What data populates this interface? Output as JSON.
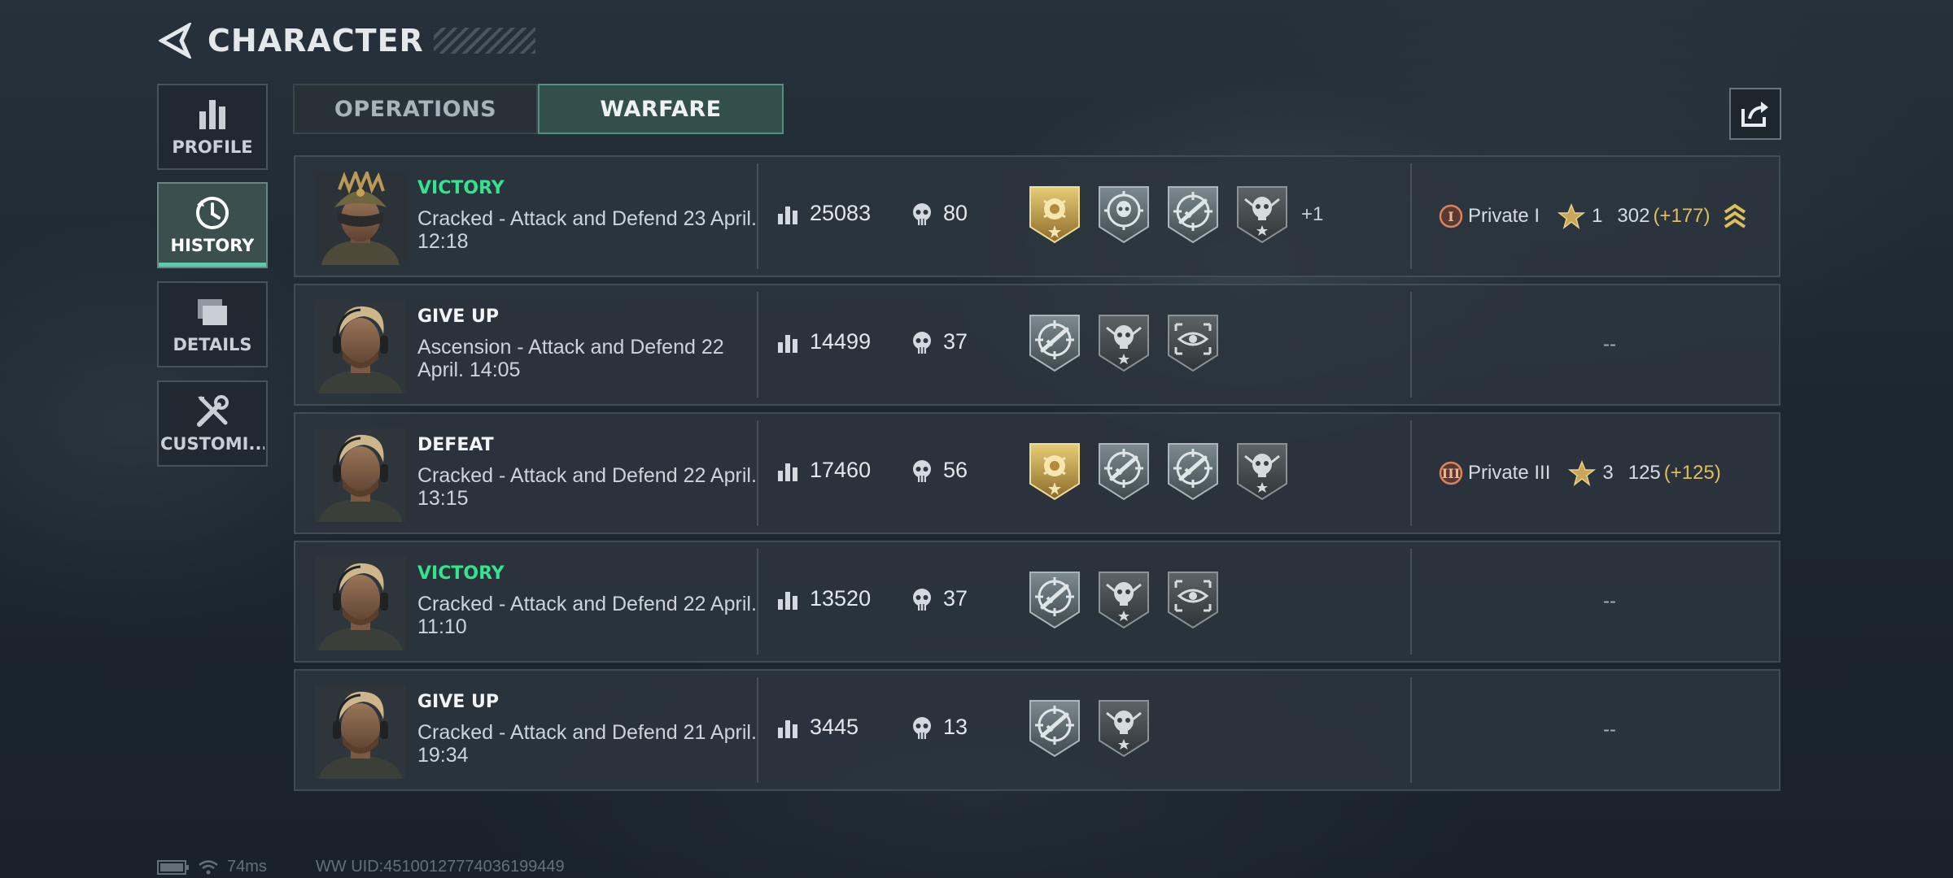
{
  "header": {
    "title": "CHARACTER"
  },
  "sidebar": {
    "items": [
      {
        "label": "PROFILE"
      },
      {
        "label": "HISTORY",
        "active": true
      },
      {
        "label": "DETAILS"
      },
      {
        "label": "CUSTOMI..."
      }
    ]
  },
  "tabs": [
    {
      "label": "OPERATIONS"
    },
    {
      "label": "WARFARE",
      "active": true
    }
  ],
  "colors": {
    "accent": "#4ad3ad",
    "victory": "#35e28d",
    "gain": "#e0bf5a"
  },
  "matches": [
    {
      "result": "VICTORY",
      "desc": "Cracked - Attack and Defend 23 April. 12:18",
      "score": "25083",
      "kills": "80",
      "medals": [
        "gold-badge-icon",
        "skull-target-icon",
        "crosshair-rifle-icon",
        "skull-star-icon"
      ],
      "extra": "+1",
      "rank": {
        "name": "Private I",
        "stars": "1",
        "points": "302",
        "gain": "(+177)"
      }
    },
    {
      "result": "GIVE UP",
      "desc": "Ascension - Attack and Defend 22 April. 14:05",
      "score": "14499",
      "kills": "37",
      "medals": [
        "crosshair-rifle-icon",
        "skull-star-icon",
        "scope-eye-icon"
      ],
      "empty": "--"
    },
    {
      "result": "DEFEAT",
      "desc": "Cracked - Attack and Defend 22 April. 13:15",
      "score": "17460",
      "kills": "56",
      "medals": [
        "gold-badge-icon",
        "crosshair-rifle-icon",
        "crosshair-rifle-icon",
        "skull-star-icon"
      ],
      "rank": {
        "name": "Private III",
        "stars": "3",
        "points": "125",
        "gain": "(+125)"
      }
    },
    {
      "result": "VICTORY",
      "desc": "Cracked - Attack and Defend 22 April. 11:10",
      "score": "13520",
      "kills": "37",
      "medals": [
        "crosshair-rifle-icon",
        "skull-star-icon",
        "scope-eye-icon"
      ],
      "empty": "--"
    },
    {
      "result": "GIVE UP",
      "desc": "Cracked - Attack and Defend 21 April. 19:34",
      "score": "3445",
      "kills": "13",
      "medals": [
        "crosshair-rifle-icon",
        "skull-star-icon"
      ],
      "empty": "--"
    }
  ],
  "footer": {
    "ping": "74ms",
    "uid": "WW UID:451001277740361994​49"
  }
}
